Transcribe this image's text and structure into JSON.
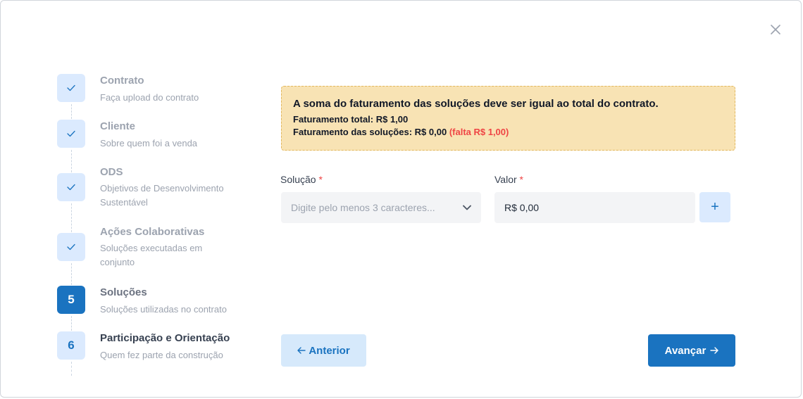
{
  "dialog": {
    "close_icon": "close-icon"
  },
  "stepper": {
    "steps": [
      {
        "status": "done",
        "title": "Contrato",
        "subtitle": "Faça upload do contrato"
      },
      {
        "status": "done",
        "title": "Cliente",
        "subtitle": "Sobre quem foi a venda"
      },
      {
        "status": "done",
        "title": "ODS",
        "subtitle": "Objetivos de Desenvolvimento Sustentável"
      },
      {
        "status": "done",
        "title": "Ações Colaborativas",
        "subtitle": "Soluções executadas em conjunto"
      },
      {
        "status": "active",
        "number": "5",
        "title": "Soluções",
        "subtitle": "Soluções utilizadas no contrato"
      },
      {
        "status": "pending",
        "number": "6",
        "title": "Participação e Orientação",
        "subtitle": "Quem fez parte da construção"
      }
    ]
  },
  "alert": {
    "title": "A soma do faturamento das soluções deve ser igual ao total do contrato.",
    "total_line": "Faturamento total: R$ 1,00",
    "solutions_line": "Faturamento das soluções: R$ 0,00",
    "missing": "(falta R$ 1,00)"
  },
  "form": {
    "solution_label": "Solução",
    "solution_placeholder": "Digite pelo menos 3 caracteres...",
    "value_label": "Valor",
    "value": "R$ 0,00",
    "required_mark": "*",
    "add_label": "+"
  },
  "nav": {
    "prev_label": "Anterior",
    "next_label": "Avançar"
  },
  "colors": {
    "primary": "#1a73c0",
    "primary_light": "#dbeafe",
    "warning_bg": "#f8e3b4",
    "danger": "#ef4444"
  }
}
